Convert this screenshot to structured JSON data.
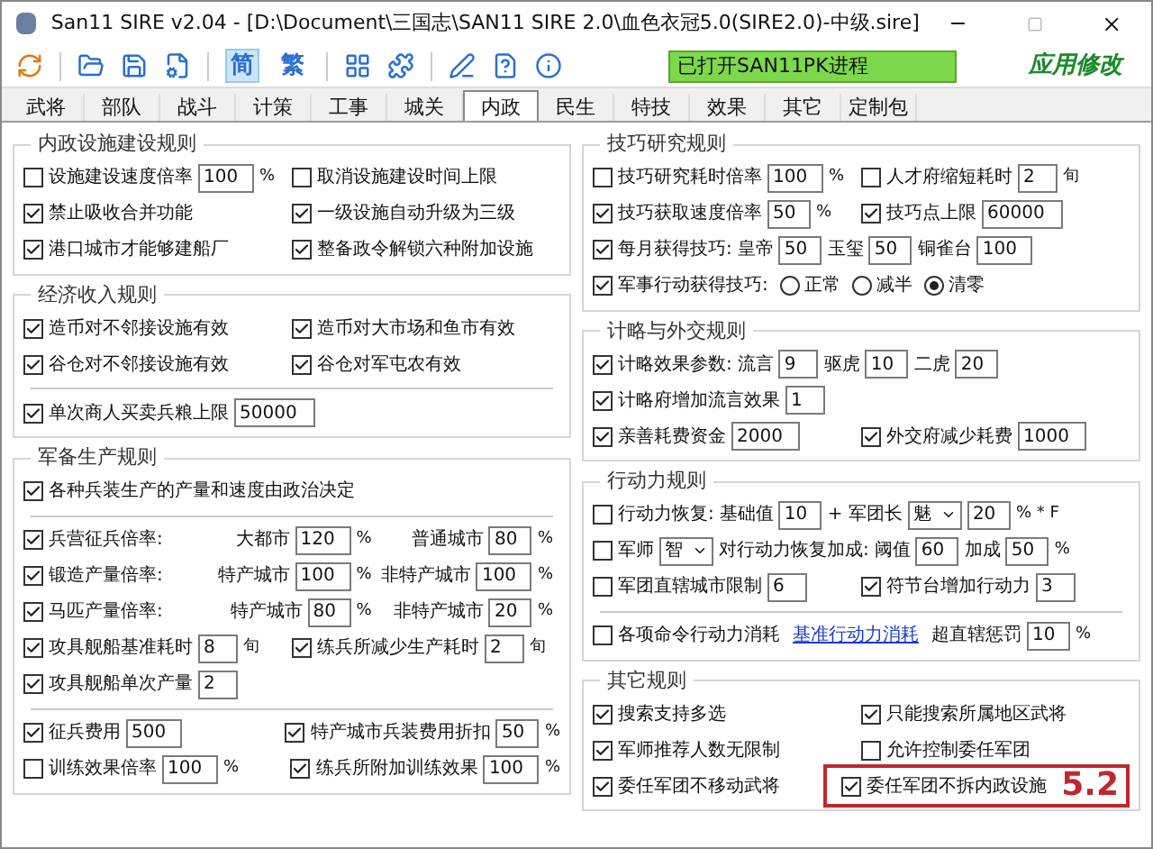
{
  "window": {
    "title": "San11 SIRE v2.04 - [D:\\Document\\三国志\\SAN11 SIRE 2.0\\血色衣冠5.0(SIRE2.0)-中级.sire]"
  },
  "toolbar": {
    "language_buttons": [
      {
        "label": "简",
        "selected": true
      },
      {
        "label": "繁",
        "selected": false
      }
    ],
    "status": "已打开SAN11PK进程",
    "apply_button": "应用修改"
  },
  "tabs": [
    {
      "label": "武将",
      "selected": false
    },
    {
      "label": "部队",
      "selected": false
    },
    {
      "label": "战斗",
      "selected": false
    },
    {
      "label": "计策",
      "selected": false
    },
    {
      "label": "工事",
      "selected": false
    },
    {
      "label": "城关",
      "selected": false
    },
    {
      "label": "内政",
      "selected": true
    },
    {
      "label": "民生",
      "selected": false
    },
    {
      "label": "特技",
      "selected": false
    },
    {
      "label": "效果",
      "selected": false
    },
    {
      "label": "其它",
      "selected": false
    },
    {
      "label": "定制包",
      "selected": false
    }
  ],
  "columns": [
    {
      "groups": [
        {
          "title": "内政设施建设规则",
          "rows": [
            {
              "kind": "row",
              "cells": [
                {
                  "items": [
                    {
                      "kind": "check",
                      "label": "设施建设速度倍率",
                      "checked": false
                    },
                    {
                      "kind": "input",
                      "value": "100"
                    },
                    {
                      "kind": "unit",
                      "text": "%"
                    }
                  ]
                },
                {
                  "items": [
                    {
                      "kind": "check",
                      "label": "取消设施建设时间上限",
                      "checked": false
                    }
                  ]
                }
              ]
            },
            {
              "kind": "row",
              "cells": [
                {
                  "items": [
                    {
                      "kind": "check",
                      "label": "禁止吸收合并功能",
                      "checked": true
                    }
                  ]
                },
                {
                  "items": [
                    {
                      "kind": "check",
                      "label": "一级设施自动升级为三级",
                      "checked": true
                    }
                  ]
                }
              ]
            },
            {
              "kind": "row",
              "cells": [
                {
                  "items": [
                    {
                      "kind": "check",
                      "label": "港口城市才能够建船厂",
                      "checked": true
                    }
                  ]
                },
                {
                  "items": [
                    {
                      "kind": "check",
                      "label": "整备政令解锁六种附加设施",
                      "checked": true
                    }
                  ]
                }
              ]
            }
          ]
        },
        {
          "title": "经济收入规则",
          "rows": [
            {
              "kind": "row",
              "cells": [
                {
                  "items": [
                    {
                      "kind": "check",
                      "label": "造币对不邻接设施有效",
                      "checked": true
                    }
                  ]
                },
                {
                  "items": [
                    {
                      "kind": "check",
                      "label": "造币对大市场和鱼市有效",
                      "checked": true
                    }
                  ]
                }
              ]
            },
            {
              "kind": "row",
              "cells": [
                {
                  "items": [
                    {
                      "kind": "check",
                      "label": "谷仓对不邻接设施有效",
                      "checked": true
                    }
                  ]
                },
                {
                  "items": [
                    {
                      "kind": "check",
                      "label": "谷仓对军屯农有效",
                      "checked": true
                    }
                  ]
                }
              ]
            },
            {
              "kind": "separator"
            },
            {
              "kind": "row",
              "cells": [
                {
                  "items": [
                    {
                      "kind": "check",
                      "label": "单次商人买卖兵粮上限",
                      "checked": true
                    },
                    {
                      "kind": "input",
                      "value": "50000"
                    }
                  ]
                }
              ]
            }
          ]
        },
        {
          "title": "军备生产规则",
          "rows": [
            {
              "kind": "row",
              "cells": [
                {
                  "items": [
                    {
                      "kind": "check",
                      "label": "各种兵装生产的产量和速度由政治决定",
                      "checked": true
                    }
                  ]
                }
              ]
            },
            {
              "kind": "separator"
            },
            {
              "kind": "row",
              "cells": [
                {
                  "items": [
                    {
                      "kind": "check",
                      "label": "兵营征兵倍率:",
                      "checked": true
                    }
                  ]
                },
                {
                  "items": [
                    {
                      "kind": "text",
                      "text": "大都市"
                    },
                    {
                      "kind": "input",
                      "value": "120"
                    },
                    {
                      "kind": "unit",
                      "text": "%"
                    }
                  ]
                },
                {
                  "items": [
                    {
                      "kind": "text",
                      "text": "普通城市"
                    },
                    {
                      "kind": "input",
                      "value": "80"
                    },
                    {
                      "kind": "unit",
                      "text": "%"
                    }
                  ]
                }
              ]
            },
            {
              "kind": "row",
              "cells": [
                {
                  "items": [
                    {
                      "kind": "check",
                      "label": "锻造产量倍率:",
                      "checked": true
                    }
                  ]
                },
                {
                  "items": [
                    {
                      "kind": "text",
                      "text": "特产城市"
                    },
                    {
                      "kind": "input",
                      "value": "100"
                    },
                    {
                      "kind": "unit",
                      "text": "%"
                    }
                  ]
                },
                {
                  "items": [
                    {
                      "kind": "text",
                      "text": "非特产城市"
                    },
                    {
                      "kind": "input",
                      "value": "100"
                    },
                    {
                      "kind": "unit",
                      "text": "%"
                    }
                  ]
                }
              ]
            },
            {
              "kind": "row",
              "cells": [
                {
                  "items": [
                    {
                      "kind": "check",
                      "label": "马匹产量倍率:",
                      "checked": true
                    }
                  ]
                },
                {
                  "items": [
                    {
                      "kind": "text",
                      "text": "特产城市"
                    },
                    {
                      "kind": "input",
                      "value": "80"
                    },
                    {
                      "kind": "unit",
                      "text": "%"
                    }
                  ]
                },
                {
                  "items": [
                    {
                      "kind": "text",
                      "text": "非特产城市"
                    },
                    {
                      "kind": "input",
                      "value": "20"
                    },
                    {
                      "kind": "unit",
                      "text": "%"
                    }
                  ]
                }
              ]
            },
            {
              "kind": "row",
              "cells": [
                {
                  "items": [
                    {
                      "kind": "check",
                      "label": "攻具舰船基准耗时",
                      "checked": true
                    },
                    {
                      "kind": "input",
                      "value": "8"
                    },
                    {
                      "kind": "unit",
                      "text": "旬"
                    }
                  ]
                },
                {
                  "items": [
                    {
                      "kind": "check",
                      "label": "练兵所减少生产耗时",
                      "checked": true
                    },
                    {
                      "kind": "input",
                      "value": "2"
                    },
                    {
                      "kind": "unit",
                      "text": "旬"
                    }
                  ]
                }
              ]
            },
            {
              "kind": "row",
              "cells": [
                {
                  "items": [
                    {
                      "kind": "check",
                      "label": "攻具舰船单次产量",
                      "checked": true
                    },
                    {
                      "kind": "input",
                      "value": "2"
                    }
                  ]
                }
              ]
            },
            {
              "kind": "separator"
            },
            {
              "kind": "row",
              "cells": [
                {
                  "items": [
                    {
                      "kind": "check",
                      "label": "征兵费用",
                      "checked": true
                    },
                    {
                      "kind": "input",
                      "value": "500"
                    }
                  ]
                },
                {
                  "items": [
                    {
                      "kind": "check",
                      "label": "特产城市兵装费用折扣",
                      "checked": true
                    },
                    {
                      "kind": "input",
                      "value": "50"
                    },
                    {
                      "kind": "unit",
                      "text": "%"
                    }
                  ]
                }
              ]
            },
            {
              "kind": "row",
              "cells": [
                {
                  "items": [
                    {
                      "kind": "check",
                      "label": "训练效果倍率",
                      "checked": false
                    },
                    {
                      "kind": "input",
                      "value": "100"
                    },
                    {
                      "kind": "unit",
                      "text": "%"
                    }
                  ]
                },
                {
                  "items": [
                    {
                      "kind": "check",
                      "label": "练兵所附加训练效果",
                      "checked": true
                    },
                    {
                      "kind": "input",
                      "value": "100"
                    },
                    {
                      "kind": "unit",
                      "text": "%"
                    }
                  ]
                }
              ]
            }
          ]
        }
      ]
    },
    {
      "groups": [
        {
          "title": "技巧研究规则",
          "rows": [
            {
              "kind": "row",
              "cells": [
                {
                  "items": [
                    {
                      "kind": "check",
                      "label": "技巧研究耗时倍率",
                      "checked": false
                    },
                    {
                      "kind": "input",
                      "value": "100"
                    },
                    {
                      "kind": "unit",
                      "text": "%"
                    }
                  ]
                },
                {
                  "items": [
                    {
                      "kind": "check",
                      "label": "人才府缩短耗时",
                      "checked": false
                    },
                    {
                      "kind": "input",
                      "value": "2"
                    },
                    {
                      "kind": "unit",
                      "text": "旬"
                    }
                  ]
                }
              ]
            },
            {
              "kind": "row",
              "cells": [
                {
                  "items": [
                    {
                      "kind": "check",
                      "label": "技巧获取速度倍率",
                      "checked": true
                    },
                    {
                      "kind": "input",
                      "value": "50"
                    },
                    {
                      "kind": "unit",
                      "text": "%"
                    }
                  ]
                },
                {
                  "items": [
                    {
                      "kind": "check",
                      "label": "技巧点上限",
                      "checked": true
                    },
                    {
                      "kind": "input",
                      "value": "60000"
                    }
                  ]
                }
              ]
            },
            {
              "kind": "row",
              "cells": [
                {
                  "items": [
                    {
                      "kind": "check",
                      "label": "每月获得技巧:",
                      "checked": true
                    },
                    {
                      "kind": "text",
                      "text": "皇帝"
                    },
                    {
                      "kind": "input",
                      "value": "50"
                    },
                    {
                      "kind": "text",
                      "text": "玉玺"
                    },
                    {
                      "kind": "input",
                      "value": "50"
                    },
                    {
                      "kind": "text",
                      "text": "铜雀台"
                    },
                    {
                      "kind": "input",
                      "value": "100"
                    }
                  ]
                }
              ]
            },
            {
              "kind": "row",
              "cells": [
                {
                  "items": [
                    {
                      "kind": "check",
                      "label": "军事行动获得技巧:",
                      "checked": true
                    },
                    {
                      "kind": "radio",
                      "label": "正常",
                      "selected": false
                    },
                    {
                      "kind": "radio",
                      "label": "减半",
                      "selected": false
                    },
                    {
                      "kind": "radio",
                      "label": "清零",
                      "selected": true
                    }
                  ]
                }
              ]
            }
          ]
        },
        {
          "title": "计略与外交规则",
          "rows": [
            {
              "kind": "row",
              "cells": [
                {
                  "items": [
                    {
                      "kind": "check",
                      "label": "计略效果参数:",
                      "checked": true
                    },
                    {
                      "kind": "text",
                      "text": "流言"
                    },
                    {
                      "kind": "input",
                      "value": "9"
                    },
                    {
                      "kind": "text",
                      "text": "驱虎"
                    },
                    {
                      "kind": "input",
                      "value": "10"
                    },
                    {
                      "kind": "text",
                      "text": "二虎"
                    },
                    {
                      "kind": "input",
                      "value": "20"
                    }
                  ]
                }
              ]
            },
            {
              "kind": "row",
              "cells": [
                {
                  "items": [
                    {
                      "kind": "check",
                      "label": "计略府增加流言效果",
                      "checked": true
                    },
                    {
                      "kind": "input",
                      "value": "1"
                    }
                  ]
                }
              ]
            },
            {
              "kind": "row",
              "cells": [
                {
                  "items": [
                    {
                      "kind": "check",
                      "label": "亲善耗费资金",
                      "checked": true
                    },
                    {
                      "kind": "input",
                      "value": "2000"
                    }
                  ]
                },
                {
                  "items": [
                    {
                      "kind": "check",
                      "label": "外交府减少耗费",
                      "checked": true
                    },
                    {
                      "kind": "input",
                      "value": "1000"
                    }
                  ]
                }
              ]
            }
          ]
        },
        {
          "title": "行动力规则",
          "rows": [
            {
              "kind": "row",
              "cells": [
                {
                  "items": [
                    {
                      "kind": "check",
                      "label": "行动力恢复:",
                      "checked": false
                    },
                    {
                      "kind": "text",
                      "text": "基础值"
                    },
                    {
                      "kind": "input",
                      "value": "10"
                    },
                    {
                      "kind": "text",
                      "text": "+ 军团长"
                    },
                    {
                      "kind": "select",
                      "value": "魅"
                    },
                    {
                      "kind": "input",
                      "value": "20"
                    },
                    {
                      "kind": "unit",
                      "text": "% * F"
                    }
                  ]
                }
              ]
            },
            {
              "kind": "row",
              "cells": [
                {
                  "items": [
                    {
                      "kind": "check",
                      "label": "军师",
                      "checked": false
                    },
                    {
                      "kind": "select",
                      "value": "智"
                    },
                    {
                      "kind": "text",
                      "text": "对行动力恢复加成:"
                    },
                    {
                      "kind": "text",
                      "text": "阈值"
                    },
                    {
                      "kind": "input",
                      "value": "60"
                    },
                    {
                      "kind": "text",
                      "text": "加成"
                    },
                    {
                      "kind": "input",
                      "value": "50"
                    },
                    {
                      "kind": "unit",
                      "text": "%"
                    }
                  ]
                }
              ]
            },
            {
              "kind": "row",
              "cells": [
                {
                  "items": [
                    {
                      "kind": "check",
                      "label": "军团直辖城市限制",
                      "checked": false
                    },
                    {
                      "kind": "input",
                      "value": "6"
                    }
                  ]
                },
                {
                  "items": [
                    {
                      "kind": "check",
                      "label": "符节台增加行动力",
                      "checked": true
                    },
                    {
                      "kind": "input",
                      "value": "3"
                    }
                  ]
                }
              ]
            },
            {
              "kind": "separator"
            },
            {
              "kind": "row",
              "cells": [
                {
                  "items": [
                    {
                      "kind": "check",
                      "label": "各项命令行动力消耗",
                      "checked": false
                    },
                    {
                      "kind": "link",
                      "text": "基准行动力消耗"
                    },
                    {
                      "kind": "text",
                      "text": "超直辖惩罚"
                    },
                    {
                      "kind": "input",
                      "value": "10"
                    },
                    {
                      "kind": "unit",
                      "text": "%"
                    }
                  ]
                }
              ]
            }
          ]
        },
        {
          "title": "其它规则",
          "rows": [
            {
              "kind": "row",
              "cells": [
                {
                  "items": [
                    {
                      "kind": "check",
                      "label": "搜索支持多选",
                      "checked": true
                    }
                  ]
                },
                {
                  "items": [
                    {
                      "kind": "check",
                      "label": "只能搜索所属地区武将",
                      "checked": true
                    }
                  ]
                }
              ]
            },
            {
              "kind": "row",
              "cells": [
                {
                  "items": [
                    {
                      "kind": "check",
                      "label": "军师推荐人数无限制",
                      "checked": true
                    }
                  ]
                },
                {
                  "items": [
                    {
                      "kind": "check",
                      "label": "允许控制委任军团",
                      "checked": false
                    }
                  ]
                }
              ]
            },
            {
              "kind": "row",
              "cells": [
                {
                  "items": [
                    {
                      "kind": "check",
                      "label": "委任军团不移动武将",
                      "checked": true
                    }
                  ]
                },
                {
                  "annotation": "5.2",
                  "items": [
                    {
                      "kind": "check",
                      "label": "委任军团不拆内政设施",
                      "checked": true
                    }
                  ]
                }
              ]
            }
          ]
        }
      ]
    }
  ]
}
